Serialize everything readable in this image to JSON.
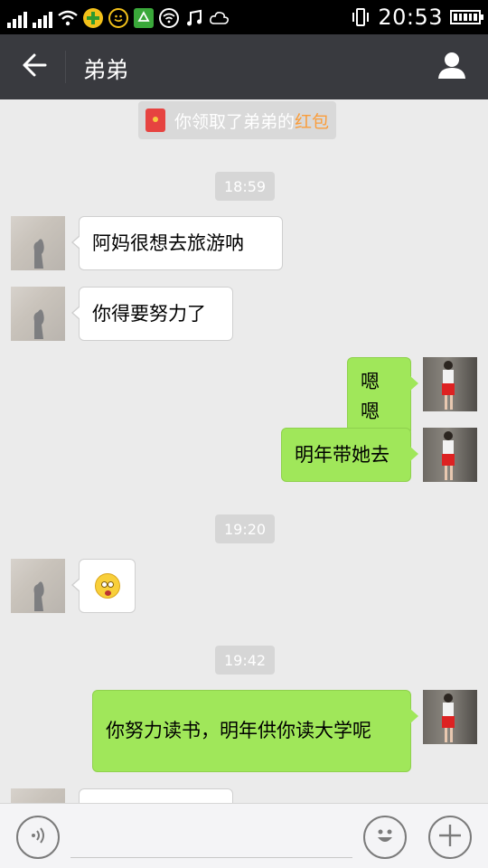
{
  "status_bar": {
    "time": "20:53"
  },
  "header": {
    "title": "弟弟",
    "back_icon": "back-arrow-icon",
    "profile_icon": "user-icon"
  },
  "system_notice": {
    "prefix": "你领取了弟弟的",
    "highlight": "红包"
  },
  "timestamps": [
    "18:59",
    "19:20",
    "19:42"
  ],
  "messages": [
    {
      "side": "in",
      "text": "阿妈很想去旅游呐"
    },
    {
      "side": "in",
      "text": "你得要努力了"
    },
    {
      "side": "out",
      "text": "嗯嗯"
    },
    {
      "side": "out",
      "text": "明年带她去"
    },
    {
      "side": "in",
      "emoji": "dizzy-face-emoji"
    },
    {
      "side": "out",
      "text": "你努力读书，明年供你读大学呢"
    }
  ],
  "input_bar": {
    "placeholder": "",
    "voice_icon": "voice-icon",
    "emoji_icon": "emoji-icon",
    "plus_icon": "plus-icon"
  }
}
